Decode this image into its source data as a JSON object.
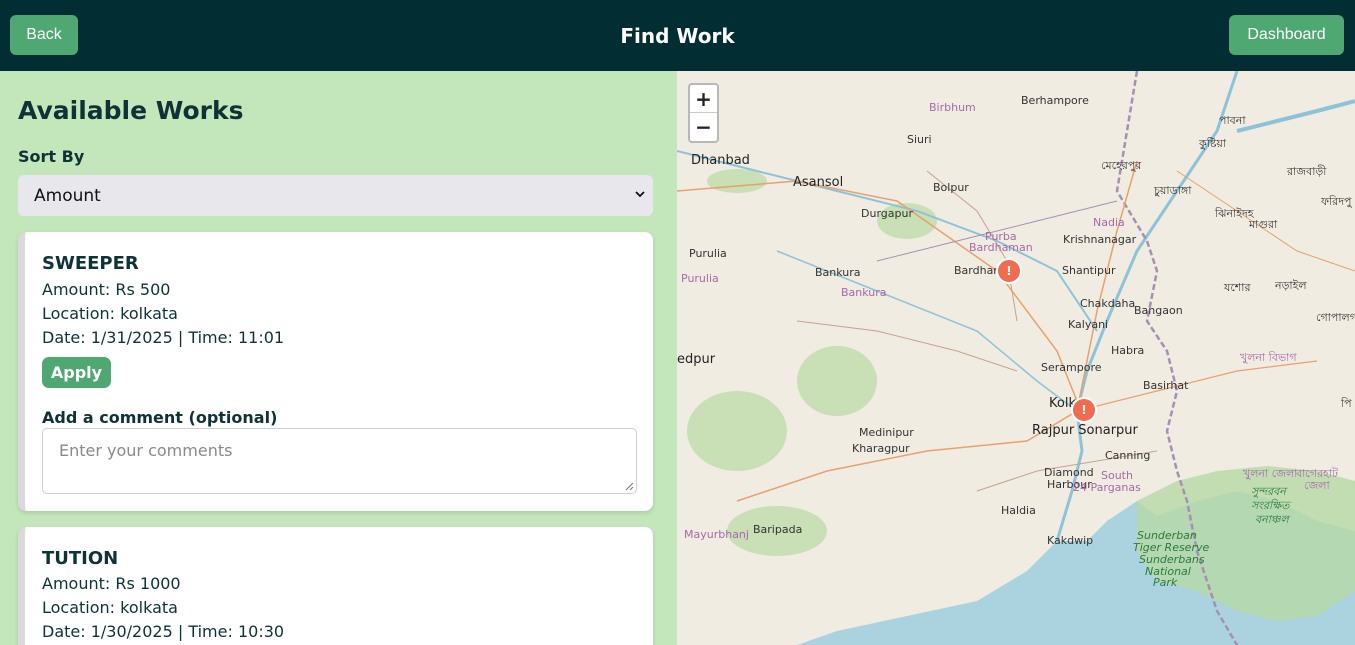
{
  "header": {
    "back_label": "Back",
    "title": "Find Work",
    "dashboard_label": "Dashboard"
  },
  "works": {
    "heading": "Available Works",
    "sort_label": "Sort By",
    "sort_selected": "Amount",
    "items": [
      {
        "title": "SWEEPER",
        "amount": "Amount: Rs 500",
        "location": "Location: kolkata",
        "datetime": "Date: 1/31/2025 | Time: 11:01",
        "apply_label": "Apply",
        "comment_label": "Add a comment (optional)",
        "comment_placeholder": "Enter your comments"
      },
      {
        "title": "TUTION",
        "amount": "Amount: Rs 1000",
        "location": "Location: kolkata",
        "datetime": "Date: 1/30/2025 | Time: 10:30"
      }
    ]
  },
  "map": {
    "zoom_in": "+",
    "zoom_out": "−",
    "marker_glyph": "!",
    "places": {
      "dhanbad": "Dhanbad",
      "asansol": "Asansol",
      "siuri": "Siuri",
      "birbhum": "Birbhum",
      "berhampore": "Berhampore",
      "bolpur": "Bolpur",
      "durgapur": "Durgapur",
      "purulia": "Purulia",
      "purulia_dist": "Purulia",
      "bankura": "Bankura",
      "bankura_dist": "Bankura",
      "purba": "Purba",
      "bardhaman_dist": "Bardhaman",
      "bardham": "Bardham",
      "krishnanagar": "Krishnanagar",
      "nadia": "Nadia",
      "shantipur": "Shantipur",
      "chakdaha": "Chakdaha",
      "bangaon": "Bangaon",
      "kalyani": "Kalyani",
      "habra": "Habra",
      "edpur": "edpur",
      "serampore": "Serampore",
      "basirhat": "Basirhat",
      "kolk": "Kolk",
      "rajpur": "Rajpur Sonarpur",
      "medinipur": "Medinipur",
      "kharagpur": "Kharagpur",
      "canning": "Canning",
      "diamond": "Diamond",
      "harbour": "Harbour",
      "south": "South",
      "parganas": "24 Parganas",
      "haldia": "Haldia",
      "kakdwip": "Kakdwip",
      "baripada": "Baripada",
      "mayurbhanj": "Mayurbhanj",
      "sunderban1": "Sunderban",
      "sunderban2": "Tiger Reserve",
      "sunderban3": "Sunderbans",
      "sunderban4": "National",
      "sunderban5": "Park",
      "bn_pabna": "পাবনা",
      "bn_kushtia": "কুষ্টিয়া",
      "bn_meherpur": "মেহেরপুর",
      "bn_rajbari": "রাজবাড়ী",
      "bn_faridpur": "ফরিদপু",
      "bn_chuadanga": "চুয়াডাঙ্গা",
      "bn_jhenaidah": "ঝিনাইদহ",
      "bn_magura": "মাগুরা",
      "bn_jessore": "যশোর",
      "bn_narail": "নড়াইল",
      "bn_gopalganj": "গোপালগঞ",
      "bn_khulna_div": "খুলনা বিভাগ",
      "bn_khulna": "খুলনা জেলা",
      "bn_bagerhat1": "বাগেরহাট",
      "bn_bagerhat2": "জেলা",
      "bn_sundarban1": "সুন্দরবন",
      "bn_sundarban2": "সংরক্ষিত",
      "bn_sundarban3": "বনাঞ্চল",
      "bn_pi": "পি"
    }
  },
  "colors": {
    "header_bg": "#022e33",
    "accent": "#4fa771",
    "panel_bg": "#c3e6bb",
    "marker": "#f06b4f"
  }
}
